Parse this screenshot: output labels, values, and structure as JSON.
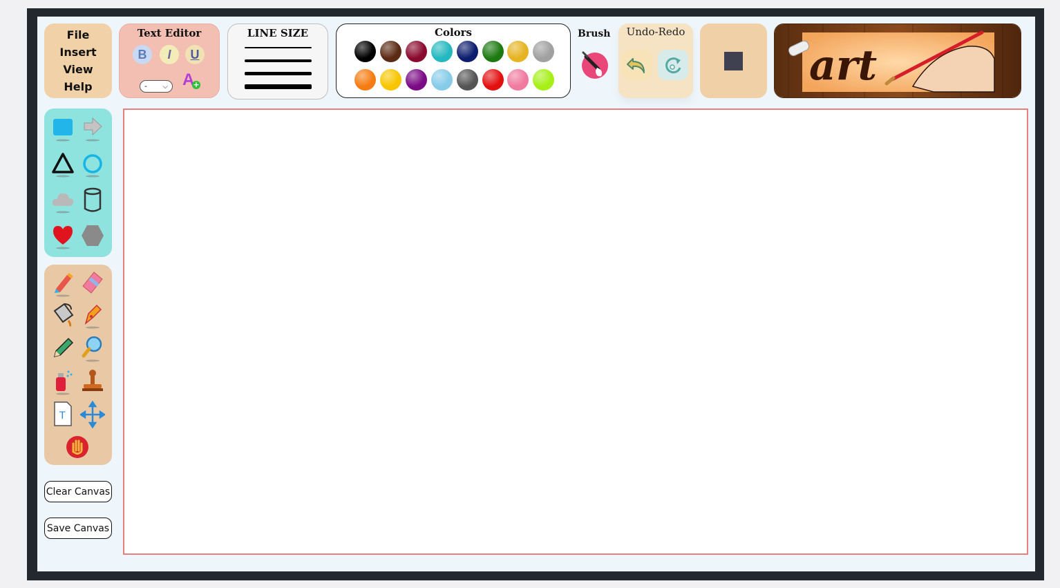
{
  "menu": {
    "items": [
      "File",
      "Insert",
      "View",
      "Help"
    ]
  },
  "text_editor": {
    "title": "Text Editor",
    "bold": "B",
    "italic": "I",
    "underline": "U",
    "font_select_value": "-",
    "font_color_icon": "A"
  },
  "line_size": {
    "title": "LINE SIZE"
  },
  "colors": {
    "title": "Colors",
    "swatches": [
      "#000000",
      "#5a2a14",
      "#8a0a2e",
      "#25b8bf",
      "#0d1d6e",
      "#1d7a12",
      "#e6b422",
      "#a0a0a0",
      "#f57c12",
      "#f7c600",
      "#7a0a85",
      "#86cce9",
      "#555555",
      "#e31010",
      "#f07aa0",
      "#a6f018"
    ]
  },
  "brush": {
    "title": "Brush"
  },
  "undo_redo": {
    "title": "Undo-Redo"
  },
  "logo": {
    "text": "art"
  },
  "shape_tools": [
    "rectangle-icon",
    "arrow-icon",
    "triangle-icon",
    "circle-icon",
    "cloud-icon",
    "cylinder-icon",
    "heart-icon",
    "hexagon-icon"
  ],
  "draw_tools": [
    "marker-icon",
    "eraser-icon",
    "paint-bucket-icon",
    "pen-nib-icon",
    "pencil-icon",
    "magnifier-icon",
    "spray-can-icon",
    "stamp-icon",
    "text-box-icon",
    "move-icon",
    "hand-icon"
  ],
  "buttons": {
    "clear": "Clear Canvas",
    "save": "Save Canvas"
  }
}
